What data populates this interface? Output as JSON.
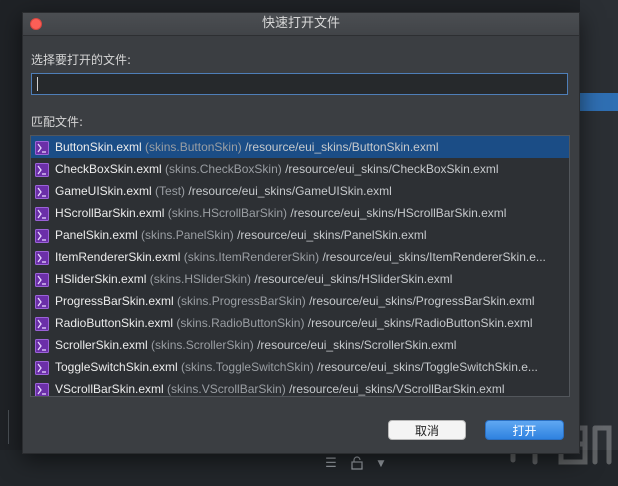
{
  "dialog": {
    "title": "快速打开文件",
    "select_label": "选择要打开的文件:",
    "match_label": "匹配文件:",
    "search_value": "",
    "cancel_label": "取消",
    "open_label": "打开"
  },
  "files": [
    {
      "name": "ButtonSkin.exml",
      "class": "(skins.ButtonSkin)",
      "path": "/resource/eui_skins/ButtonSkin.exml",
      "selected": true
    },
    {
      "name": "CheckBoxSkin.exml",
      "class": "(skins.CheckBoxSkin)",
      "path": "/resource/eui_skins/CheckBoxSkin.exml"
    },
    {
      "name": "GameUISkin.exml",
      "class": "(Test)",
      "path": "/resource/eui_skins/GameUISkin.exml"
    },
    {
      "name": "HScrollBarSkin.exml",
      "class": "(skins.HScrollBarSkin)",
      "path": "/resource/eui_skins/HScrollBarSkin.exml"
    },
    {
      "name": "PanelSkin.exml",
      "class": "(skins.PanelSkin)",
      "path": "/resource/eui_skins/PanelSkin.exml"
    },
    {
      "name": "ItemRendererSkin.exml",
      "class": "(skins.ItemRendererSkin)",
      "path": "/resource/eui_skins/ItemRendererSkin.e..."
    },
    {
      "name": "HSliderSkin.exml",
      "class": "(skins.HSliderSkin)",
      "path": "/resource/eui_skins/HSliderSkin.exml"
    },
    {
      "name": "ProgressBarSkin.exml",
      "class": "(skins.ProgressBarSkin)",
      "path": "/resource/eui_skins/ProgressBarSkin.exml"
    },
    {
      "name": "RadioButtonSkin.exml",
      "class": "(skins.RadioButtonSkin)",
      "path": "/resource/eui_skins/RadioButtonSkin.exml"
    },
    {
      "name": "ScrollerSkin.exml",
      "class": "(skins.ScrollerSkin)",
      "path": "/resource/eui_skins/ScrollerSkin.exml"
    },
    {
      "name": "ToggleSwitchSkin.exml",
      "class": "(skins.ToggleSwitchSkin)",
      "path": "/resource/eui_skins/ToggleSwitchSkin.e..."
    },
    {
      "name": "VScrollBarSkin.exml",
      "class": "(skins.VScrollBarSkin)",
      "path": "/resource/eui_skins/VScrollBarSkin.exml"
    }
  ],
  "icons": {
    "file_icon": "exml-file-icon",
    "close": "close-icon"
  },
  "colors": {
    "selection": "#1b4d86",
    "open_button": "#2f82e0",
    "close_button": "#fb5f57"
  }
}
